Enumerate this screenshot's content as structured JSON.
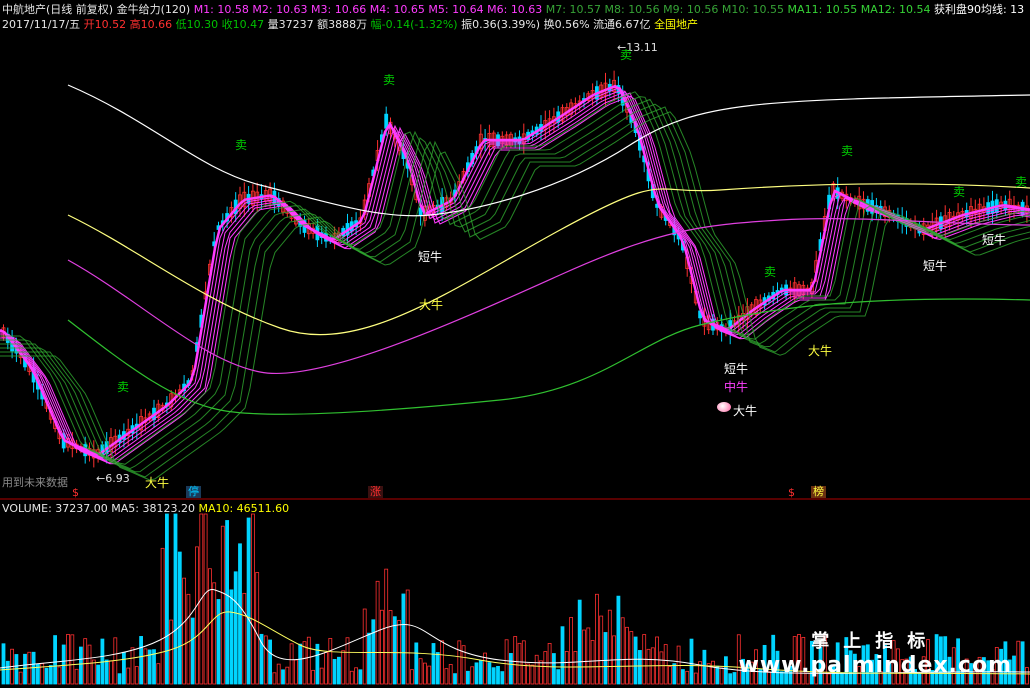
{
  "header": {
    "stock": "中航地产(日线 前复权)",
    "indicator": "金牛给力(120)",
    "ma_items": [
      {
        "label": "M1: 10.58",
        "color": "#ff3cff"
      },
      {
        "label": "M2: 10.63",
        "color": "#ff3cff"
      },
      {
        "label": "M3: 10.66",
        "color": "#ff3cff"
      },
      {
        "label": "M4: 10.65",
        "color": "#ff3cff"
      },
      {
        "label": "M5: 10.64",
        "color": "#ff3cff"
      },
      {
        "label": "M6: 10.63",
        "color": "#ff3cff"
      },
      {
        "label": "M7: 10.57",
        "color": "#36a336"
      },
      {
        "label": "M8: 10.56",
        "color": "#36a336"
      },
      {
        "label": "M9: 10.56",
        "color": "#36a336"
      },
      {
        "label": "M10: 10.55",
        "color": "#36a336"
      },
      {
        "label": "MA11: 10.55",
        "color": "#36d336"
      },
      {
        "label": "MA12: 10.54",
        "color": "#36d336"
      },
      {
        "label": "获利盘90均线: 13",
        "color": "#ffffff"
      }
    ],
    "date": "2017/11/17/五",
    "open_label": "开",
    "open_value": "10.52",
    "high_label": "高",
    "high_value": "10.66",
    "low_label": "低",
    "low_value": "10.30",
    "close_label": "收",
    "close_value": "10.47",
    "volume_text": "量37237",
    "amount_text": "额3888万",
    "change_text": "幅-0.14(-1.32%)",
    "amplitude_text": "振0.36(3.39%)",
    "turnover_text": "换0.56%",
    "float_text": "流通6.67亿",
    "sector_text": "全国地产"
  },
  "signals": {
    "sell": "卖",
    "short_bull": "短牛",
    "big_bull": "大牛",
    "mid_bull": "中牛",
    "high_price": "13.11",
    "low_price": "6.93"
  },
  "tags": {
    "s1": "$",
    "ting": "停",
    "zhang": "涨",
    "s2": "$",
    "bang": "榜"
  },
  "future_data_text": "用到未来数据",
  "volume_header": {
    "vol": "VOLUME: 37237.00",
    "ma5": "MA5: 38123.20",
    "ma10": "MA10: 46511.60"
  },
  "watermark": {
    "title": "掌上指标",
    "url": "www.palmindex.com"
  },
  "colors": {
    "up_candle": "#ff3030",
    "down_candle": "#00d4ff",
    "fast_ma": "#ff3cff",
    "green_ma": "#2fa82f",
    "yellow_ma": "#ffff80",
    "white_ma": "#ffffff",
    "pink_ma": "#e040e0",
    "divider": "#b00000"
  }
}
